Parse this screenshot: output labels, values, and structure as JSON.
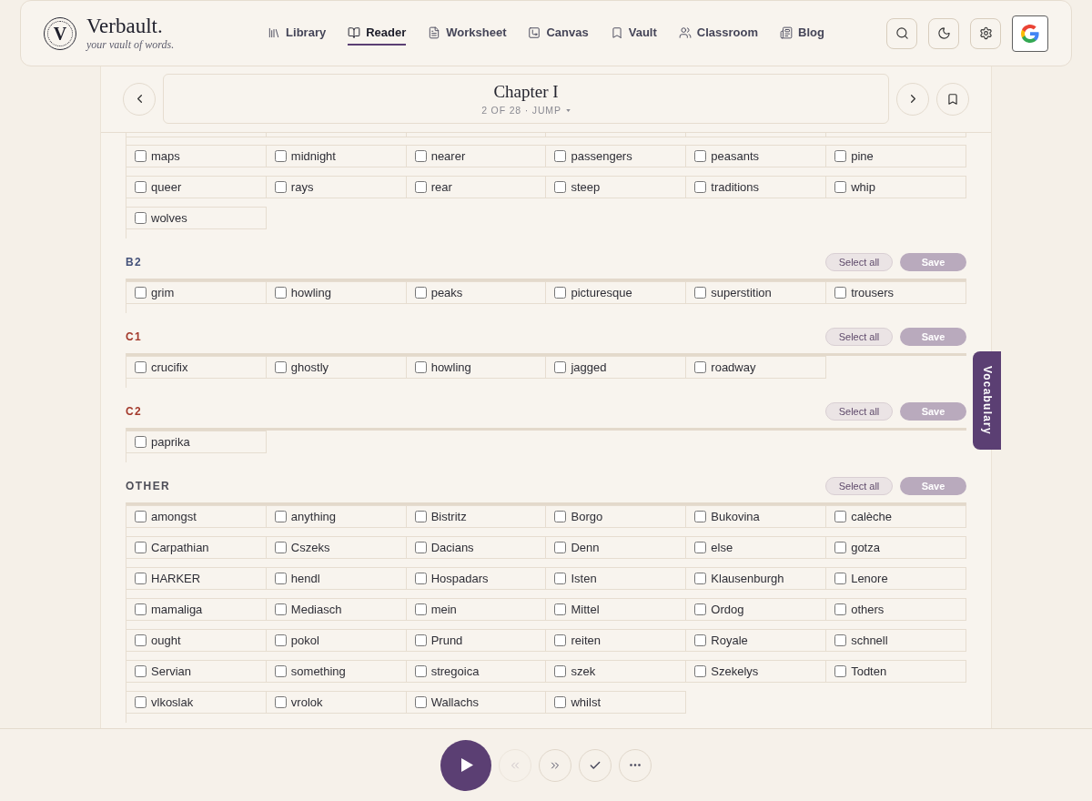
{
  "header": {
    "brand": {
      "logo_letter": "V",
      "name": "Verbault.",
      "tagline": "your vault of words."
    },
    "nav": [
      {
        "label": "Library",
        "selected": false
      },
      {
        "label": "Reader",
        "selected": true
      },
      {
        "label": "Worksheet",
        "selected": false
      },
      {
        "label": "Canvas",
        "selected": false
      },
      {
        "label": "Vault",
        "selected": false
      },
      {
        "label": "Classroom",
        "selected": false
      },
      {
        "label": "Blog",
        "selected": false
      }
    ]
  },
  "chapter": {
    "title": "Chapter I",
    "position": "2 OF 28 · JUMP"
  },
  "sections": [
    {
      "words": [
        {
          "text": "maps",
          "checked": false
        },
        {
          "text": "midnight",
          "checked": false
        },
        {
          "text": "nearer",
          "checked": false
        },
        {
          "text": "passengers",
          "checked": false
        },
        {
          "text": "peasants",
          "checked": false
        },
        {
          "text": "pine",
          "checked": false
        },
        {
          "text": "queer",
          "checked": false
        },
        {
          "text": "rays",
          "checked": false
        },
        {
          "text": "rear",
          "checked": false
        },
        {
          "text": "steep",
          "checked": false
        },
        {
          "text": "traditions",
          "checked": false
        },
        {
          "text": "whip",
          "checked": false
        },
        {
          "text": "wolves",
          "checked": false
        }
      ]
    },
    {
      "label": "B2",
      "color": "#45527a",
      "select_all": "Select all",
      "save": {
        "label": "Save",
        "disabled": true
      },
      "words": [
        {
          "text": "grim",
          "checked": false
        },
        {
          "text": "howling",
          "checked": false
        },
        {
          "text": "peaks",
          "checked": false
        },
        {
          "text": "picturesque",
          "checked": false
        },
        {
          "text": "superstition",
          "checked": false
        },
        {
          "text": "trousers",
          "checked": false
        }
      ]
    },
    {
      "label": "C1",
      "color": "#a3392b",
      "select_all": "Select all",
      "save": {
        "label": "Save",
        "disabled": true
      },
      "words": [
        {
          "text": "crucifix",
          "checked": false
        },
        {
          "text": "ghostly",
          "checked": false
        },
        {
          "text": "howling",
          "checked": false
        },
        {
          "text": "jagged",
          "checked": false
        },
        {
          "text": "roadway",
          "checked": false
        }
      ]
    },
    {
      "label": "C2",
      "color": "#a3392b",
      "select_all": "Select all",
      "save": {
        "label": "Save",
        "disabled": true
      },
      "words": [
        {
          "text": "paprika",
          "checked": false
        }
      ]
    },
    {
      "label": "OTHER",
      "color": "#4d4d57",
      "select_all": "Select all",
      "save": {
        "label": "Save",
        "disabled": true
      },
      "words": [
        {
          "text": "amongst",
          "checked": false
        },
        {
          "text": "anything",
          "checked": false
        },
        {
          "text": "Bistritz",
          "checked": false
        },
        {
          "text": "Borgo",
          "checked": false
        },
        {
          "text": "Bukovina",
          "checked": false
        },
        {
          "text": "calèche",
          "checked": false
        },
        {
          "text": "Carpathian",
          "checked": false
        },
        {
          "text": "Cszeks",
          "checked": false
        },
        {
          "text": "Dacians",
          "checked": false
        },
        {
          "text": "Denn",
          "checked": false
        },
        {
          "text": "else",
          "checked": false
        },
        {
          "text": "gotza",
          "checked": false
        },
        {
          "text": "HARKER",
          "checked": false
        },
        {
          "text": "hendl",
          "checked": false
        },
        {
          "text": "Hospadars",
          "checked": false
        },
        {
          "text": "Isten",
          "checked": false
        },
        {
          "text": "Klausenburgh",
          "checked": false
        },
        {
          "text": "Lenore",
          "checked": false
        },
        {
          "text": "mamaliga",
          "checked": false
        },
        {
          "text": "Mediasch",
          "checked": false
        },
        {
          "text": "mein",
          "checked": false
        },
        {
          "text": "Mittel",
          "checked": false
        },
        {
          "text": "Ordog",
          "checked": false
        },
        {
          "text": "others",
          "checked": false
        },
        {
          "text": "ought",
          "checked": false
        },
        {
          "text": "pokol",
          "checked": false
        },
        {
          "text": "Prund",
          "checked": false
        },
        {
          "text": "reiten",
          "checked": false
        },
        {
          "text": "Royale",
          "checked": false
        },
        {
          "text": "schnell",
          "checked": false
        },
        {
          "text": "Servian",
          "checked": false
        },
        {
          "text": "something",
          "checked": false
        },
        {
          "text": "stregoica",
          "checked": false
        },
        {
          "text": "szek",
          "checked": false
        },
        {
          "text": "Szekelys",
          "checked": false
        },
        {
          "text": "Todten",
          "checked": false
        },
        {
          "text": "vlkoslak",
          "checked": false
        },
        {
          "text": "vrolok",
          "checked": false
        },
        {
          "text": "Wallachs",
          "checked": false
        },
        {
          "text": "whilst",
          "checked": false
        }
      ]
    }
  ],
  "side_tab": {
    "label": "Vocabulary"
  },
  "player": {
    "playing": false,
    "controls": [
      {
        "kind": "prev",
        "disabled": true
      },
      {
        "kind": "next",
        "disabled": false
      },
      {
        "kind": "check",
        "disabled": false
      },
      {
        "kind": "more",
        "disabled": false
      }
    ]
  }
}
